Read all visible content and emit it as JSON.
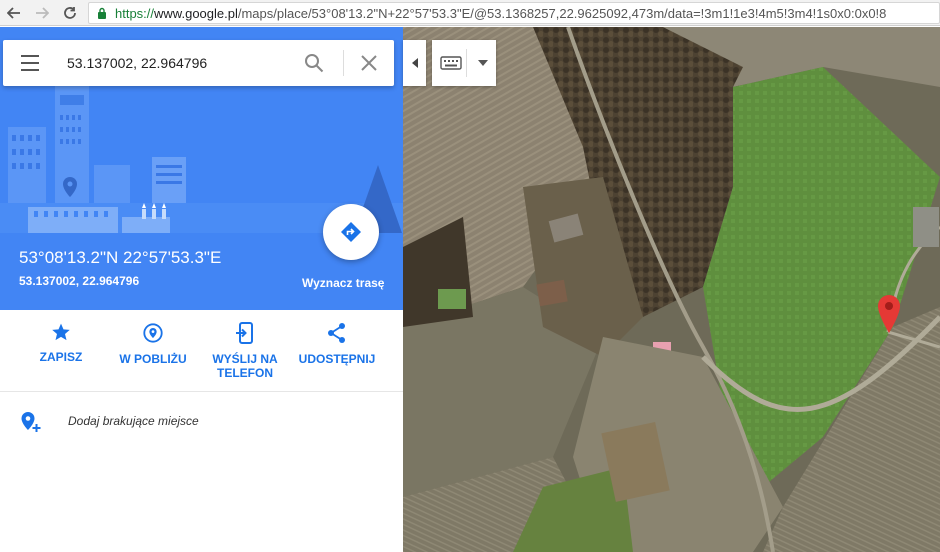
{
  "browser": {
    "url_protocol": "https://",
    "url_host": "www.google.pl",
    "url_path": "/maps/place/53°08'13.2\"N+22°57'53.3\"E/@53.1368257,22.9625092,473m/data=!3m1!1e3!4m5!3m4!1s0x0:0x0!8"
  },
  "search": {
    "value": "53.137002, 22.964796"
  },
  "place": {
    "dms": "53°08'13.2\"N 22°57'53.3\"E",
    "decimal": "53.137002, 22.964796"
  },
  "route": {
    "label": "Wyznacz trasę"
  },
  "actions": [
    {
      "label": "ZAPISZ",
      "icon": "star-icon"
    },
    {
      "label": "W POBLIŻU",
      "icon": "nearby-icon"
    },
    {
      "label": "WYŚLIJ NA TELEFON",
      "icon": "send-to-phone-icon"
    },
    {
      "label": "UDOSTĘPNIJ",
      "icon": "share-icon"
    }
  ],
  "add_place": {
    "label": "Dodaj brakujące miejsce"
  },
  "colors": {
    "header_blue": "#4285f4",
    "action_blue": "#1a73e8",
    "marker_red": "#e53935"
  },
  "map": {
    "view": "satellite"
  }
}
